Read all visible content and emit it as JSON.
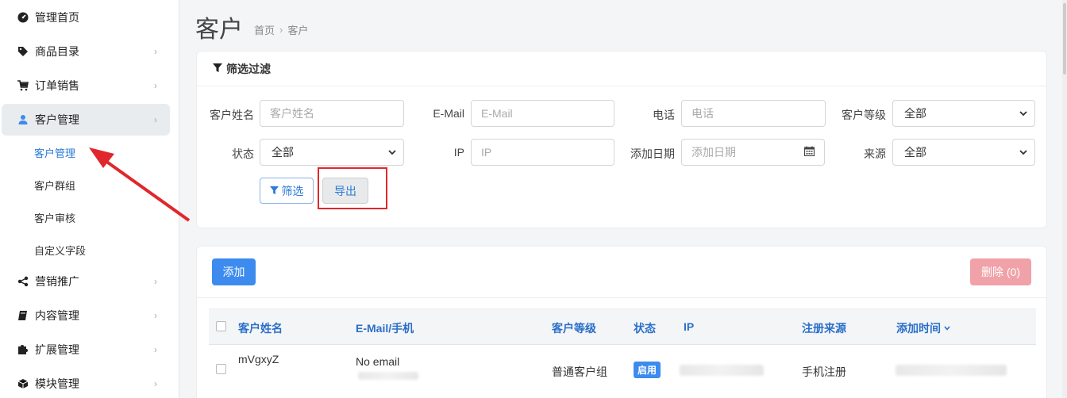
{
  "sidebar": {
    "items": [
      {
        "label": "管理首页",
        "icon": "dashboard-icon"
      },
      {
        "label": "商品目录",
        "icon": "tags-icon"
      },
      {
        "label": "订单销售",
        "icon": "cart-icon"
      },
      {
        "label": "客户管理",
        "icon": "user-icon"
      },
      {
        "label": "营销推广",
        "icon": "share-icon"
      },
      {
        "label": "内容管理",
        "icon": "book-icon"
      },
      {
        "label": "扩展管理",
        "icon": "puzzle-icon"
      },
      {
        "label": "模块管理",
        "icon": "cube-icon"
      }
    ],
    "sub_items": [
      "客户管理",
      "客户群组",
      "客户审核",
      "自定义字段"
    ]
  },
  "header": {
    "title": "客户",
    "breadcrumb": [
      "首页",
      "客户"
    ]
  },
  "filter": {
    "title": "筛选过滤",
    "fields": {
      "name_label": "客户姓名",
      "name_placeholder": "客户姓名",
      "email_label": "E-Mail",
      "email_placeholder": "E-Mail",
      "phone_label": "电话",
      "phone_placeholder": "电话",
      "level_label": "客户等级",
      "level_value": "全部",
      "status_label": "状态",
      "status_value": "全部",
      "ip_label": "IP",
      "ip_placeholder": "IP",
      "date_label": "添加日期",
      "date_placeholder": "添加日期",
      "source_label": "来源",
      "source_value": "全部"
    },
    "filter_button": "筛选",
    "export_button": "导出"
  },
  "list": {
    "add_button": "添加",
    "delete_button": "删除 (0)",
    "columns": [
      "客户姓名",
      "E-Mail/手机",
      "客户等级",
      "状态",
      "IP",
      "注册来源",
      "添加时间"
    ],
    "rows": [
      {
        "name": "mVgxyZ",
        "email": "No email",
        "level": "普通客户组",
        "status": "启用",
        "source": "手机注册"
      }
    ]
  },
  "colors": {
    "accent": "#3d8bef",
    "link": "#2a7bd8",
    "danger_light": "#f0a2a8",
    "annotation_red": "#e0272b"
  }
}
